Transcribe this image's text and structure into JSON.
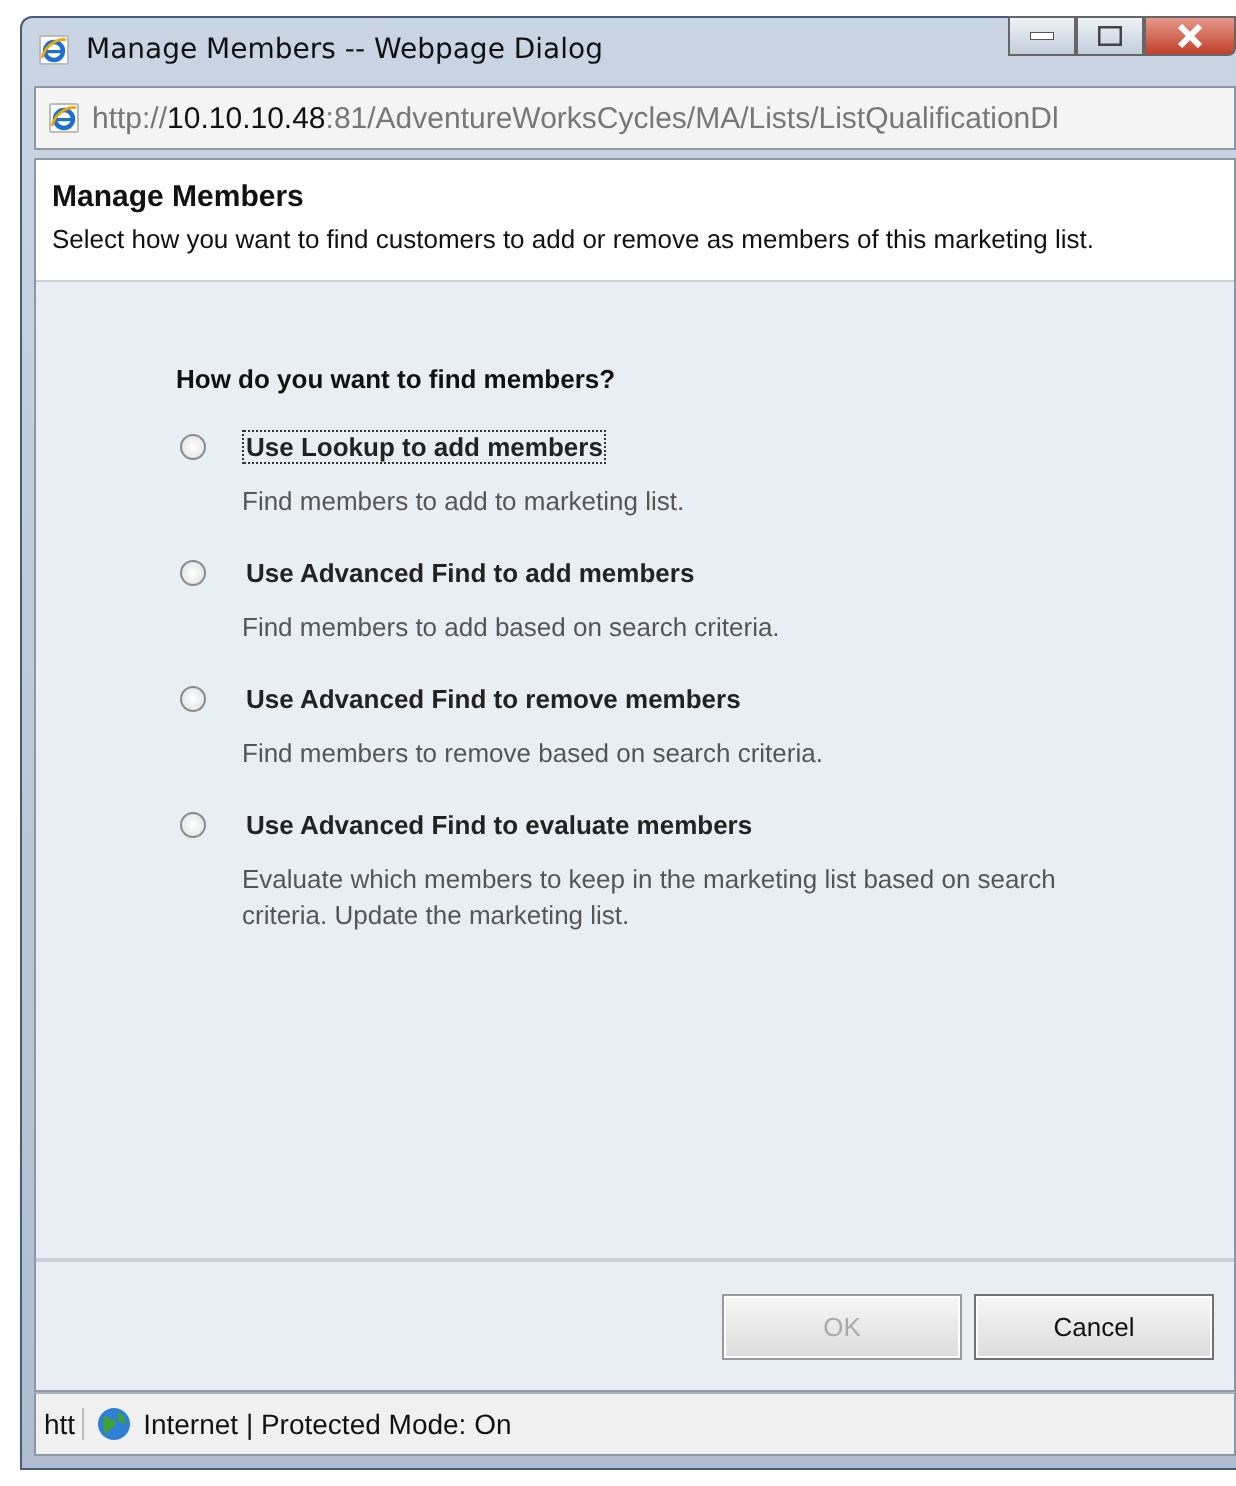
{
  "window": {
    "title": "Manage Members -- Webpage Dialog"
  },
  "address": {
    "scheme": "http://",
    "host": "10.10.10.48",
    "rest": ":81/AdventureWorksCycles/MA/Lists/ListQualificationDl"
  },
  "header": {
    "title": "Manage Members",
    "description": "Select how you want to find customers to add or remove as members of this marketing list."
  },
  "question": "How do you want to find members?",
  "options": [
    {
      "label": "Use Lookup to add members",
      "description": "Find members to add to marketing list.",
      "selected": false,
      "focused": true
    },
    {
      "label": "Use Advanced Find to add members",
      "description": "Find members to add based on search criteria.",
      "selected": false,
      "focused": false
    },
    {
      "label": "Use Advanced Find to remove members",
      "description": "Find members to remove based on search criteria.",
      "selected": false,
      "focused": false
    },
    {
      "label": "Use Advanced Find to evaluate members",
      "description": "Evaluate which members to keep in the marketing list based on search criteria. Update the marketing list.",
      "selected": false,
      "focused": false
    }
  ],
  "buttons": [
    {
      "label": "OK",
      "disabled": true
    },
    {
      "label": "Cancel",
      "disabled": false
    }
  ],
  "status_bar": {
    "url_fragment": "htt",
    "zone": "Internet | Protected Mode: On"
  }
}
